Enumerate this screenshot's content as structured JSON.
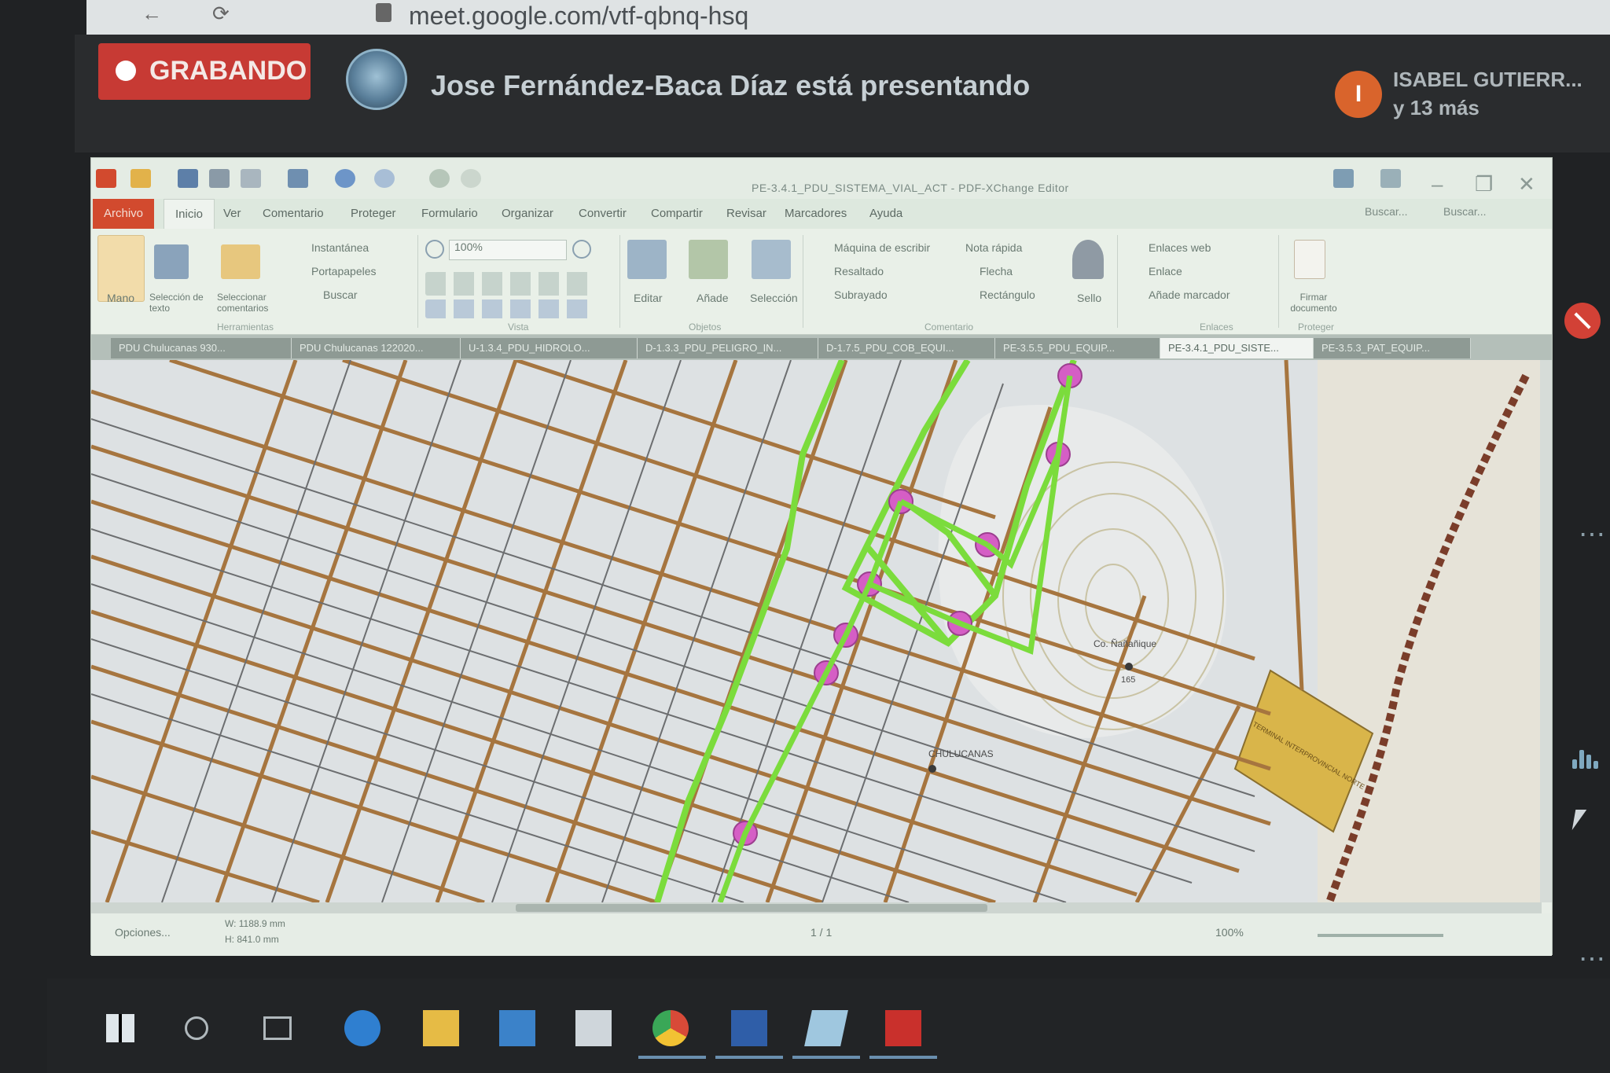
{
  "browser": {
    "url": "meet.google.com/vtf-qbnq-hsq"
  },
  "meet": {
    "recording_label": "GRABANDO",
    "presenter_text": "Jose Fernández-Baca Díaz está presentando",
    "participant_initial": "I",
    "participant_name": "ISABEL GUTIERR...",
    "participant_more": "y 13 más"
  },
  "app": {
    "title": "PE-3.4.1_PDU_SISTEMA_VIAL_ACT - PDF-XChange Editor",
    "menu": {
      "archivo": "Archivo",
      "items": [
        "Inicio",
        "Ver",
        "Comentario",
        "Proteger",
        "Formulario",
        "Organizar",
        "Convertir",
        "Compartir",
        "Revisar",
        "Marcadores",
        "Ayuda"
      ],
      "search1": "Buscar...",
      "search2": "Buscar..."
    },
    "ribbon": {
      "mano": "Mano",
      "seleccion_texto": "Selección de texto",
      "seleccionar_comentarios": "Seleccionar comentarios",
      "instantanea": "Instantánea",
      "portapapeles": "Portapapeles",
      "buscar": "Buscar",
      "zoom_value": "100%",
      "editar": "Editar",
      "anade": "Añade",
      "seleccion": "Selección",
      "maquina": "Máquina de escribir",
      "nota": "Nota rápida",
      "resaltado": "Resaltado",
      "flecha": "Flecha",
      "subrayado": "Subrayado",
      "rectangulo": "Rectángulo",
      "sello": "Sello",
      "enlaces_web": "Enlaces web",
      "enlace": "Enlace",
      "anade_marcador": "Añade marcador",
      "firmar": "Firmar documento",
      "groups": [
        "Herramientas",
        "Vista",
        "Objetos",
        "Comentario",
        "Enlaces",
        "Proteger"
      ]
    },
    "tabs": [
      "PDU Chulucanas 930...",
      "PDU Chulucanas 122020...",
      "U-1.3.4_PDU_HIDROLO...",
      "D-1.3.3_PDU_PELIGRO_IN...",
      "D-1.7.5_PDU_COB_EQUI...",
      "PE-3.5.5_PDU_EQUIP...",
      "PE-3.4.1_PDU_SISTE...",
      "PE-3.5.3_PAT_EQUIP..."
    ],
    "map_labels": {
      "hill": "Co. Ñañañique",
      "elevation": "165",
      "town": "CHULUCANAS",
      "zone": "TERMINAL INTERPROVINCIAL NORTE"
    },
    "status": {
      "opciones": "Opciones...",
      "width": "W: 1188.9 mm",
      "height": "H: 841.0 mm",
      "page": "1 / 1",
      "zoom": "100%"
    }
  },
  "colors": {
    "recording": "#c73a34",
    "route_green": "#7bdc3c",
    "node_magenta": "#d55ec5",
    "road_brown": "#a6753f",
    "zone_yellow": "#d9b54a"
  }
}
